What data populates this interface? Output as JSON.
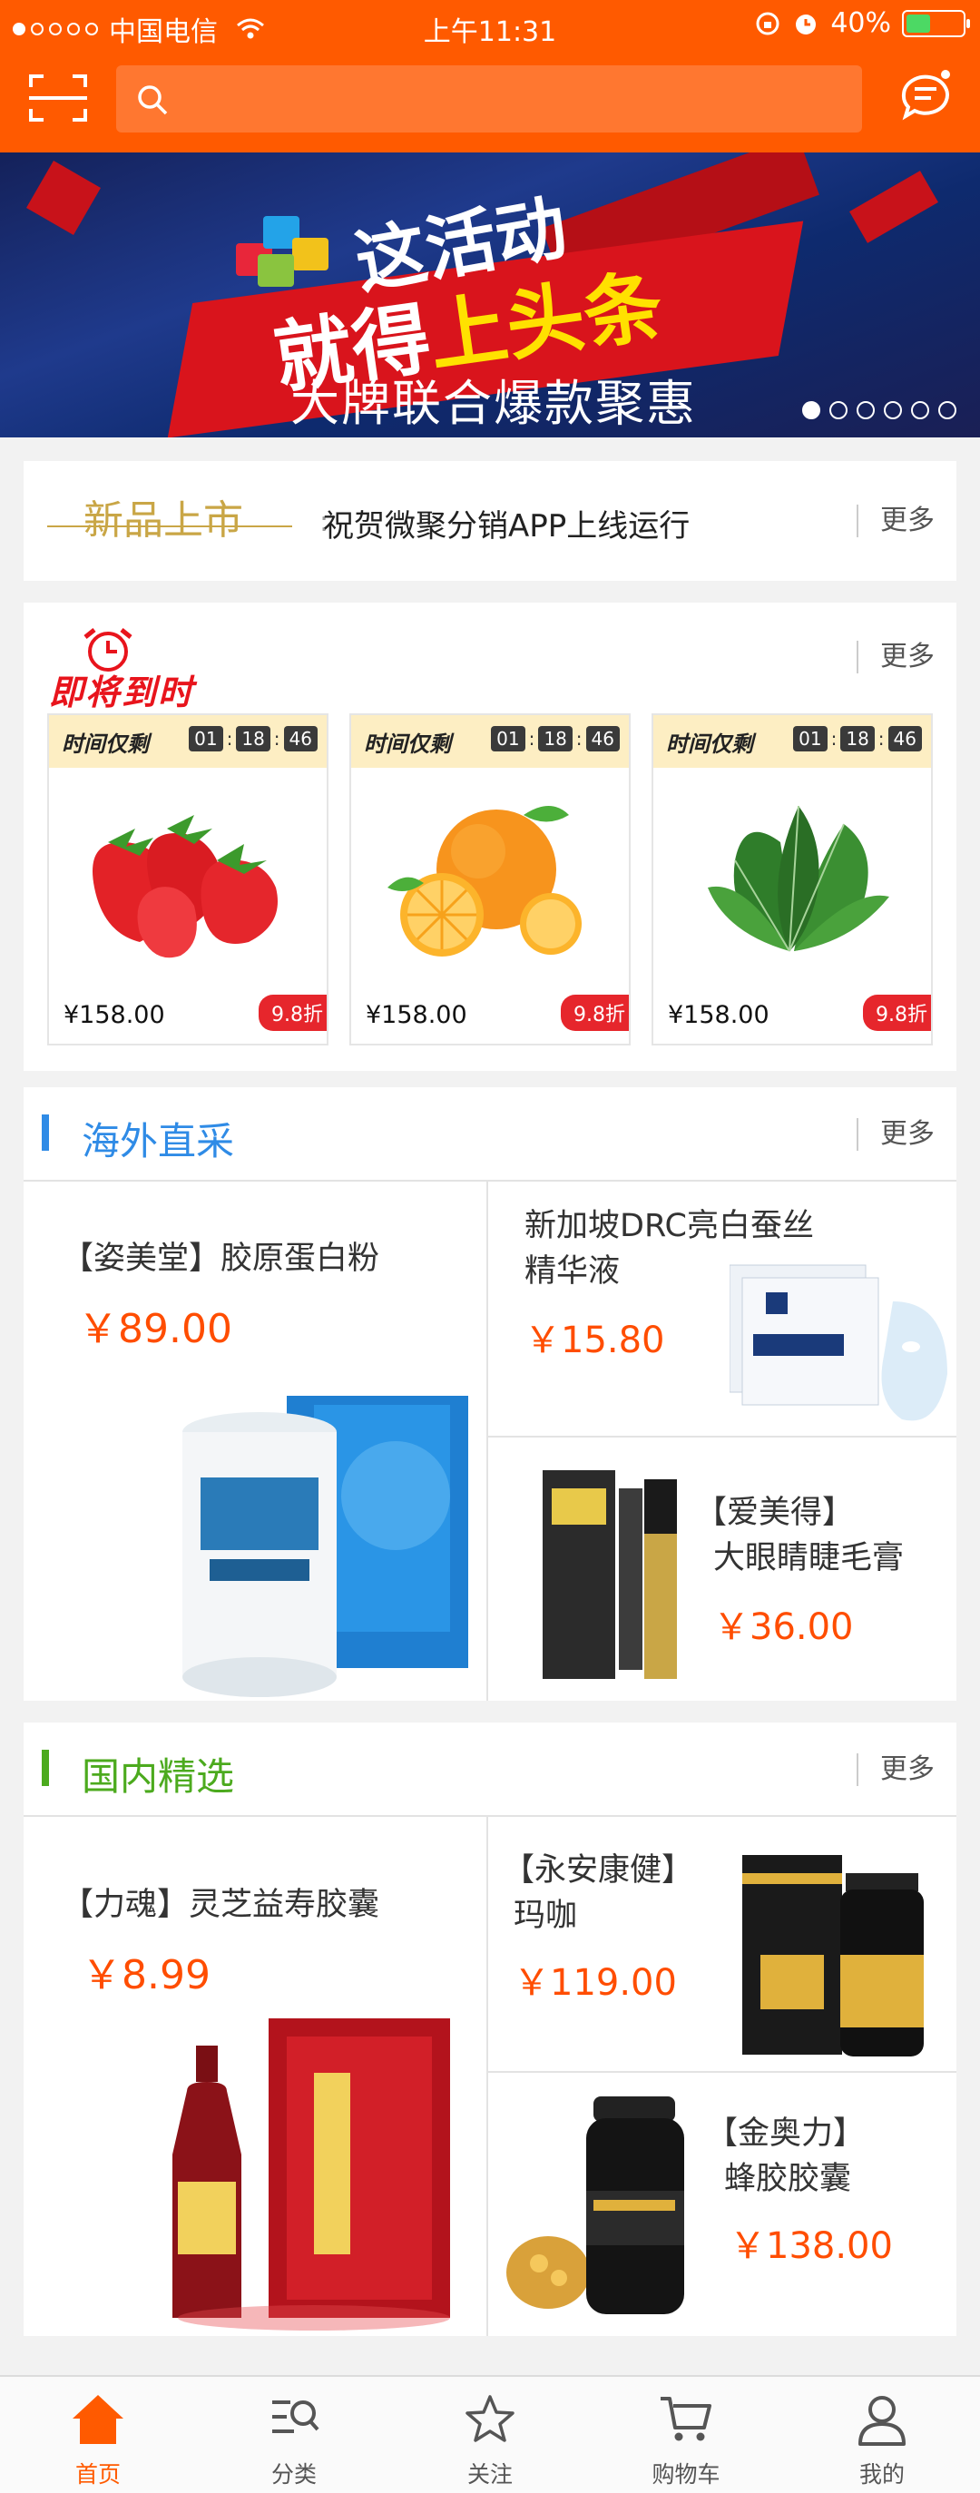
{
  "status_bar": {
    "carrier": "中国电信",
    "time": "上午11:31",
    "battery": "40%"
  },
  "header": {
    "search_placeholder": ""
  },
  "banner": {
    "line1": "这活动",
    "line2a": "就得",
    "line2b": "上头条",
    "line3": "大牌联合爆款聚惠",
    "slide_count": 6,
    "active_slide": 0
  },
  "news": {
    "logo_text": "新品上市",
    "headline": "祝贺微聚分销APP上线运行",
    "more": "更多"
  },
  "flash_sale": {
    "title": "即将到时",
    "more": "更多",
    "items": [
      {
        "countdown_label": "时间仅剩",
        "h": "01",
        "m": "18",
        "s": "46",
        "price": "¥158.00",
        "discount": "9.8折",
        "image": "strawberry"
      },
      {
        "countdown_label": "时间仅剩",
        "h": "01",
        "m": "18",
        "s": "46",
        "price": "¥158.00",
        "discount": "9.8折",
        "image": "orange"
      },
      {
        "countdown_label": "时间仅剩",
        "h": "01",
        "m": "18",
        "s": "46",
        "price": "¥158.00",
        "discount": "9.8折",
        "image": "spinach"
      }
    ]
  },
  "overseas": {
    "title": "海外直采",
    "accent": "#2f8be6",
    "more": "更多",
    "main": {
      "name": "【姿美堂】胶原蛋白粉",
      "price": "￥89.00"
    },
    "top_right": {
      "name1": "新加坡DRC亮白蚕丝",
      "name2": "精华液",
      "price": "￥15.80"
    },
    "bottom_right": {
      "name1": "【爱美得】",
      "name2": "大眼睛睫毛膏",
      "price": "￥36.00"
    }
  },
  "domestic": {
    "title": "国内精选",
    "accent": "#4caa1e",
    "more": "更多",
    "main": {
      "name": "【力魂】灵芝益寿胶囊",
      "price": "￥8.99"
    },
    "top_right": {
      "name1": "【永安康健】",
      "name2": "玛咖",
      "price": "￥119.00"
    },
    "bottom_right": {
      "name1": "【金奥力】",
      "name2": "蜂胶胶囊",
      "price": "￥138.00"
    }
  },
  "tabbar": [
    {
      "label": "首页",
      "icon": "home-icon",
      "active": true
    },
    {
      "label": "分类",
      "icon": "category-search-icon",
      "active": false
    },
    {
      "label": "关注",
      "icon": "star-icon",
      "active": false
    },
    {
      "label": "购物车",
      "icon": "cart-icon",
      "active": false
    },
    {
      "label": "我的",
      "icon": "user-icon",
      "active": false
    }
  ]
}
